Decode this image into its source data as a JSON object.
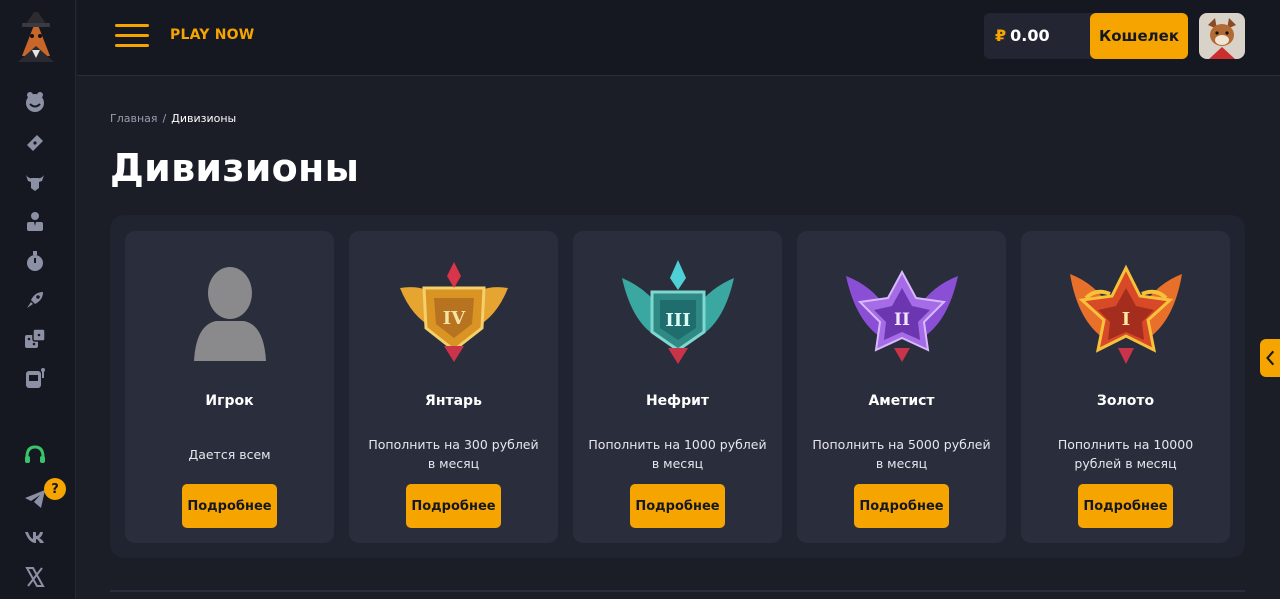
{
  "header": {
    "play_now": "PLAY NOW",
    "balance_currency": "₽",
    "balance_value": "0.00",
    "wallet_label": "Кошелек"
  },
  "sidebar": {
    "icons": [
      "smile-icon",
      "ticket-icon",
      "bull-icon",
      "player-icon",
      "stopwatch-icon",
      "rocket-icon",
      "dice-icon",
      "slot-machine-icon",
      "support-icon",
      "telegram-icon",
      "vk-icon",
      "x-icon"
    ],
    "help_badge": "?"
  },
  "breadcrumb": {
    "home": "Главная",
    "separator": "/",
    "current": "Дивизионы"
  },
  "page": {
    "title": "Дивизионы"
  },
  "divisions": [
    {
      "name": "Игрок",
      "description": "Дается всем",
      "button": "Подробнее",
      "emblem": "player-silhouette-icon"
    },
    {
      "name": "Янтарь",
      "description": "Пополнить на 300 рублей в месяц",
      "button": "Подробнее",
      "emblem": "amber-badge-icon",
      "numeral": "IV",
      "color": "#e0a22a"
    },
    {
      "name": "Нефрит",
      "description": "Пополнить на 1000 рублей в месяц",
      "button": "Подробнее",
      "emblem": "jade-badge-icon",
      "numeral": "III",
      "color": "#3fa9a4"
    },
    {
      "name": "Аметист",
      "description": "Пополнить на 5000 рублей в месяц",
      "button": "Подробнее",
      "emblem": "amethyst-badge-icon",
      "numeral": "II",
      "color": "#9b5fe0"
    },
    {
      "name": "Золото",
      "description": "Пополнить на 10000 рублей в месяц",
      "button": "Подробнее",
      "emblem": "gold-badge-icon",
      "numeral": "I",
      "color": "#e5672a"
    }
  ],
  "colors": {
    "accent": "#f5a400",
    "background": "#1b1d27",
    "card": "#2a2d3b"
  }
}
